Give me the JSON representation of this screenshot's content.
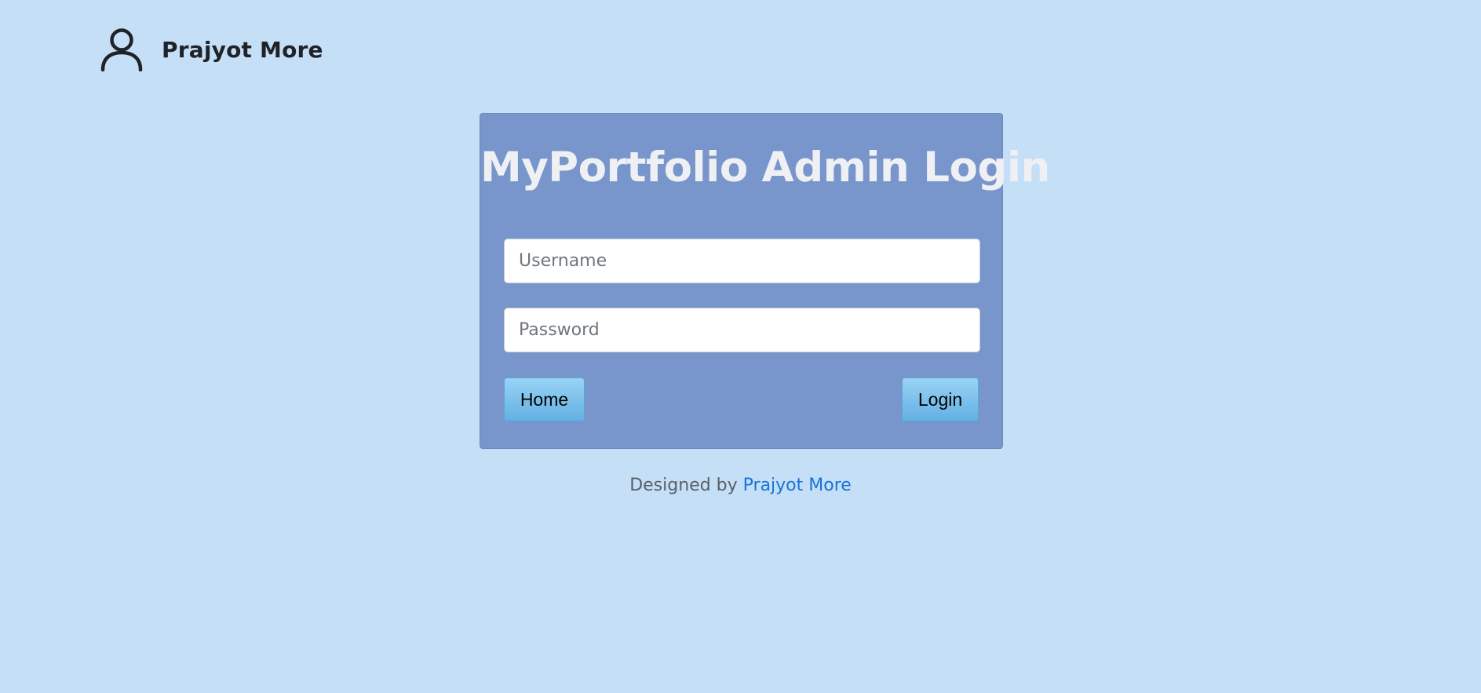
{
  "header": {
    "icon": "user-icon",
    "name": "Prajyot More"
  },
  "login_card": {
    "title": "MyPortfolio Admin Login",
    "username": {
      "placeholder": "Username",
      "value": ""
    },
    "password": {
      "placeholder": "Password",
      "value": ""
    },
    "home_label": "Home",
    "login_label": "Login"
  },
  "footer": {
    "prefix": "Designed by",
    "author_link": "Prajyot More"
  },
  "colors": {
    "page_background": "#c5dff7",
    "card_background": "#7896cb",
    "title_text": "#eef0f4",
    "button_gradient_top": "#9ad3f4",
    "button_gradient_bottom": "#62b0e3",
    "link": "#1a73d9"
  }
}
